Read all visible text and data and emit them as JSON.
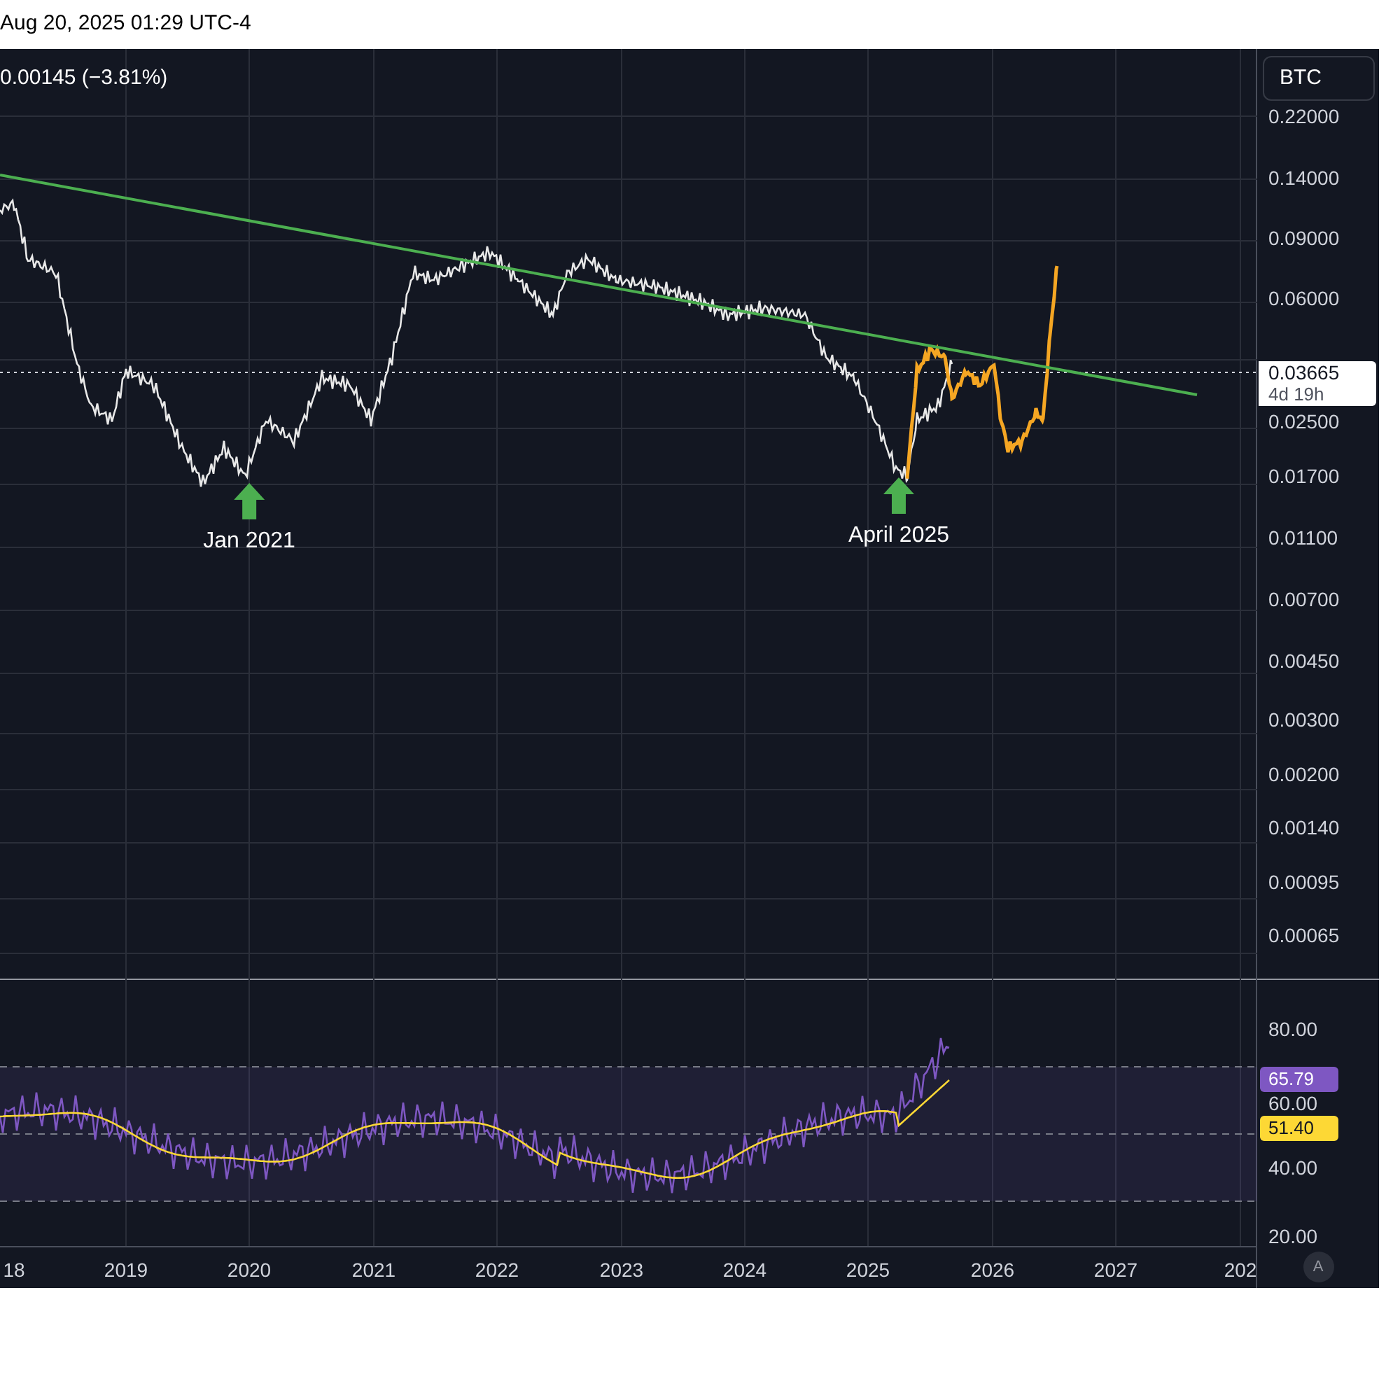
{
  "header": {
    "timestamp": "Aug 20, 2025 01:29 UTC-4"
  },
  "legend": {
    "change": "0.00145 (−3.81%)"
  },
  "symbol_button": "BTC",
  "price_axis": {
    "labels": [
      "0.22000",
      "0.14000",
      "0.09000",
      "0.06000",
      "0.02500",
      "0.01700",
      "0.01100",
      "0.00700",
      "0.00450",
      "0.00300",
      "0.00200",
      "0.00140",
      "0.00095",
      "0.00065"
    ]
  },
  "price_label": {
    "value": "0.03665",
    "countdown": "4d 19h"
  },
  "annotations": [
    {
      "label": "Jan 2021"
    },
    {
      "label": "April 2025"
    }
  ],
  "rsi_axis": {
    "labels": [
      "80.00",
      "60.00",
      "40.00",
      "20.00"
    ]
  },
  "rsi_badges": [
    {
      "value": "65.79",
      "color": "#7e57c2"
    },
    {
      "value": "51.40",
      "color": "#fdd835"
    }
  ],
  "time_axis": {
    "labels": [
      "18",
      "2019",
      "2020",
      "2021",
      "2022",
      "2023",
      "2024",
      "2025",
      "2026",
      "2027",
      "202"
    ]
  },
  "scale_button": "A"
}
